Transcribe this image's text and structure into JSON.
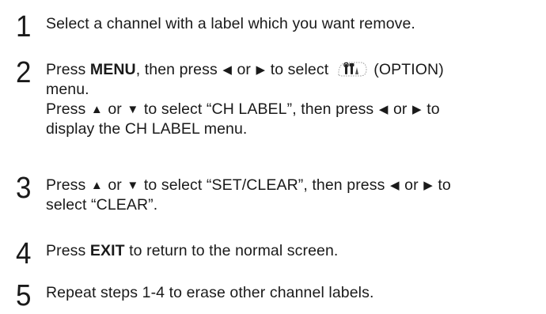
{
  "steps": [
    {
      "number": "1",
      "text": "Select a channel with a label which you want remove."
    },
    {
      "number": "2",
      "l1_press": "Press ",
      "l1_menu": "MENU",
      "l1_then": ", then press ",
      "l1_or": " or ",
      "l1_select": " to select ",
      "l1_option": " (OPTION)",
      "l2": "menu.",
      "l3_press": "Press ",
      "l3_or": " or ",
      "l3_select": " to select “CH LABEL”, then press ",
      "l3_or2": " or ",
      "l3_to": " to",
      "l4": "display the CH LABEL menu."
    },
    {
      "number": "3",
      "l1_press": "Press ",
      "l1_or": " or ",
      "l1_select": " to select “SET/CLEAR”, then press ",
      "l1_or2": " or ",
      "l1_to": " to",
      "l2": "select “CLEAR”."
    },
    {
      "number": "4",
      "press": "Press ",
      "exit": "EXIT",
      "rest": " to return to the normal screen."
    },
    {
      "number": "5",
      "text": "Repeat steps 1-4 to erase other channel labels."
    }
  ],
  "glyphs": {
    "left": "◀",
    "right": "▶",
    "up": "▲",
    "down": "▼"
  },
  "icons": {
    "option": "option-tools-icon"
  }
}
